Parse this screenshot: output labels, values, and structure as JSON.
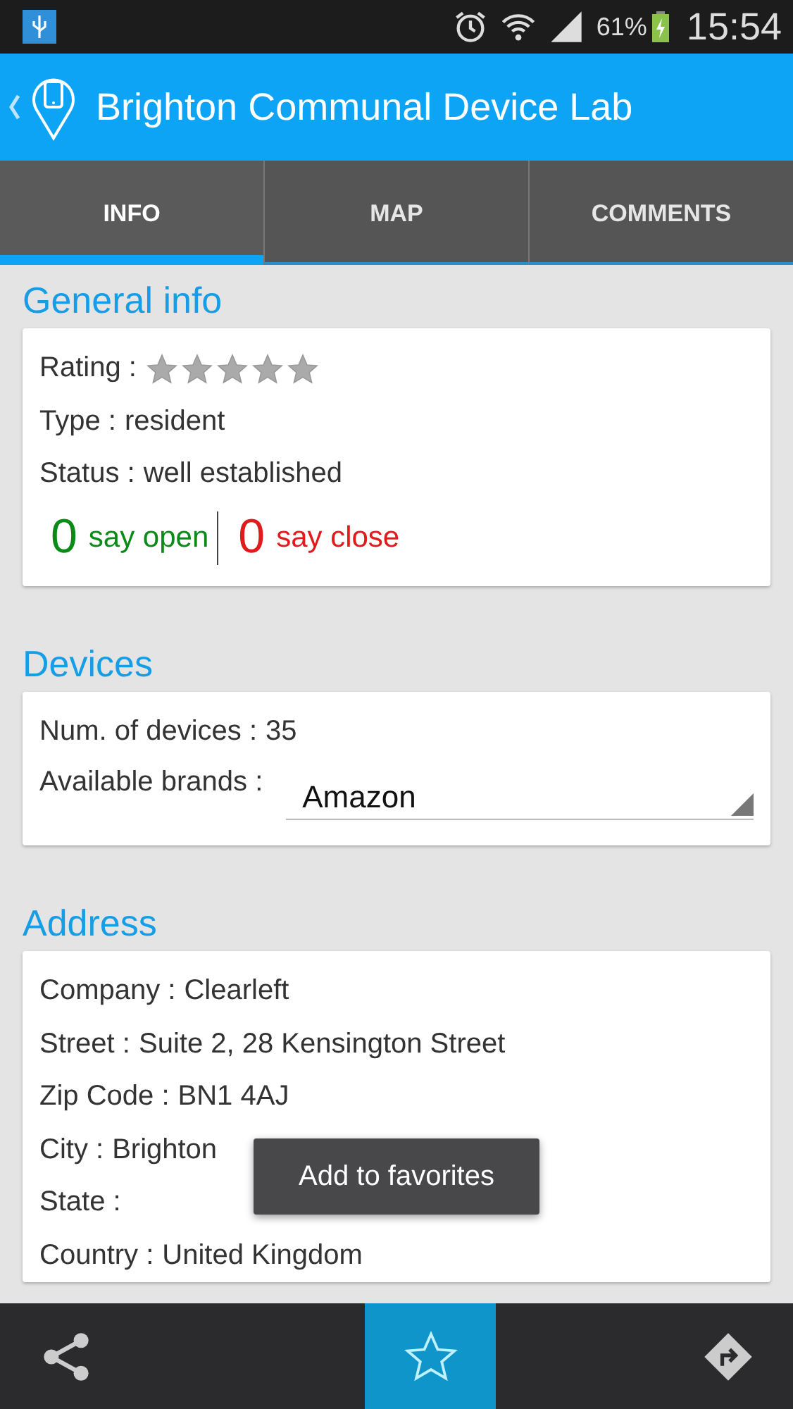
{
  "status_bar": {
    "battery": "61%",
    "time": "15:54"
  },
  "action_bar": {
    "title": "Brighton Communal Device Lab"
  },
  "tabs": [
    {
      "label": "INFO",
      "selected": true
    },
    {
      "label": "MAP",
      "selected": false
    },
    {
      "label": "COMMENTS",
      "selected": false
    }
  ],
  "general_info": {
    "title": "General info",
    "rating_label": "Rating :",
    "stars": 0,
    "type_label": "Type :",
    "type": "resident",
    "status_label": "Status :",
    "status": "well established",
    "open_count": "0",
    "open_label": "say open",
    "close_count": "0",
    "close_label": "say close"
  },
  "devices": {
    "title": "Devices",
    "count_label": "Num. of devices :",
    "count": "35",
    "brands_label": "Available brands :",
    "brand": "Amazon"
  },
  "address": {
    "title": "Address",
    "fields": [
      {
        "label": "Company :",
        "value": "Clearleft"
      },
      {
        "label": "Street :",
        "value": "Suite 2, 28 Kensington Street"
      },
      {
        "label": "Zip Code :",
        "value": "BN1 4AJ"
      },
      {
        "label": "City :",
        "value": "Brighton"
      },
      {
        "label": "State :"
      },
      {
        "label": "Country :",
        "value": "United Kingdom"
      }
    ]
  },
  "toast": "Add to favorites",
  "bottom_bar": [
    {
      "kind": "share",
      "selected": false
    },
    {
      "kind": "favorite",
      "selected": true
    },
    {
      "kind": "directions",
      "selected": false
    }
  ]
}
